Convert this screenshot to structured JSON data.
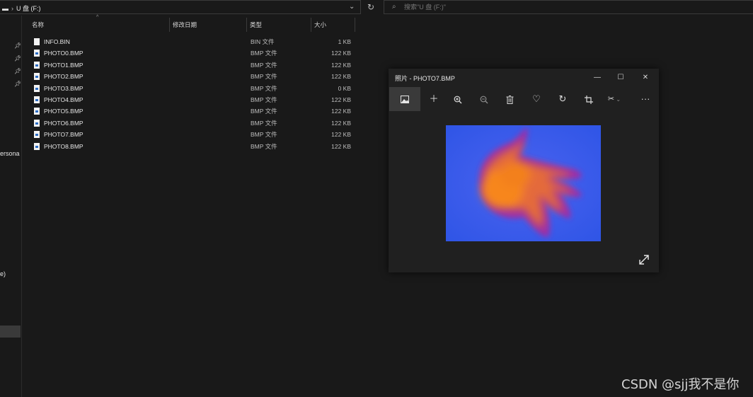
{
  "address_bar": {
    "path": [
      {
        "label": "U 盘 (F:)"
      }
    ],
    "search_placeholder": "搜索\"U 盘 (F:)\""
  },
  "nav_pane": {
    "fragments": [
      "ersona",
      "e)"
    ]
  },
  "columns": [
    {
      "label": "名称"
    },
    {
      "label": "修改日期"
    },
    {
      "label": "类型"
    },
    {
      "label": "大小"
    }
  ],
  "files": [
    {
      "name": "INFO.BIN",
      "type": "BIN 文件",
      "size": "1 KB",
      "icon": "file-icon"
    },
    {
      "name": "PHOTO0.BMP",
      "type": "BMP 文件",
      "size": "122 KB",
      "icon": "bmp-file-icon"
    },
    {
      "name": "PHOTO1.BMP",
      "type": "BMP 文件",
      "size": "122 KB",
      "icon": "bmp-file-icon"
    },
    {
      "name": "PHOTO2.BMP",
      "type": "BMP 文件",
      "size": "122 KB",
      "icon": "bmp-file-icon"
    },
    {
      "name": "PHOTO3.BMP",
      "type": "BMP 文件",
      "size": "0 KB",
      "icon": "bmp-file-icon"
    },
    {
      "name": "PHOTO4.BMP",
      "type": "BMP 文件",
      "size": "122 KB",
      "icon": "bmp-file-icon"
    },
    {
      "name": "PHOTO5.BMP",
      "type": "BMP 文件",
      "size": "122 KB",
      "icon": "bmp-file-icon"
    },
    {
      "name": "PHOTO6.BMP",
      "type": "BMP 文件",
      "size": "122 KB",
      "icon": "bmp-file-icon"
    },
    {
      "name": "PHOTO7.BMP",
      "type": "BMP 文件",
      "size": "122 KB",
      "icon": "bmp-file-icon"
    },
    {
      "name": "PHOTO8.BMP",
      "type": "BMP 文件",
      "size": "122 KB",
      "icon": "bmp-file-icon"
    }
  ],
  "photos_window": {
    "title": "照片 - PHOTO7.BMP",
    "toolbar_icons": [
      "image-icon",
      "add-icon",
      "zoom-in-icon",
      "zoom-out-icon",
      "delete-icon",
      "favorite-icon",
      "rotate-icon",
      "crop-icon",
      "edit-icon",
      "more-icon"
    ],
    "image_description_colors": {
      "background": "#3a5ee8",
      "hand_core": "#f5841f",
      "hand_edge": "#a0299a"
    }
  },
  "watermark": "CSDN @sjj我不是你",
  "colors": {
    "bg": "#191919",
    "window": "#202020",
    "text": "#e6e6e6",
    "muted": "#bdbdbd"
  }
}
